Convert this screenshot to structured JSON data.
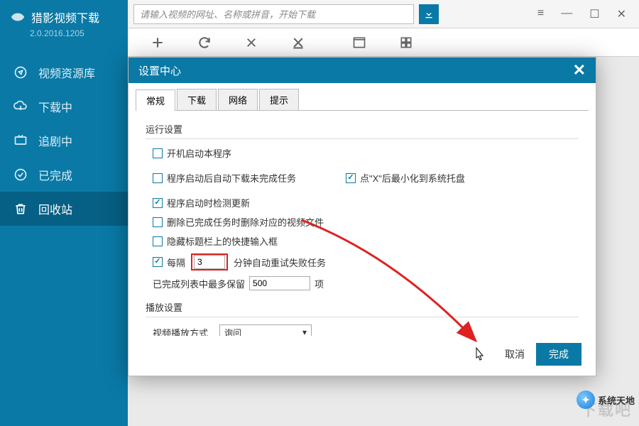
{
  "brand": {
    "title": "猎影视频下载",
    "version": "2.0.2016.1205"
  },
  "search": {
    "placeholder": "请输入视频的网址、名称或拼音，开始下载"
  },
  "nav": {
    "items": [
      {
        "label": "视频资源库"
      },
      {
        "label": "下载中"
      },
      {
        "label": "追剧中"
      },
      {
        "label": "已完成"
      },
      {
        "label": "回收站"
      }
    ]
  },
  "dialog": {
    "title": "设置中心",
    "tabs": [
      "常规",
      "下载",
      "网络",
      "提示"
    ],
    "section_run": "运行设置",
    "section_play": "播放设置",
    "opts": {
      "startup": "开机启动本程序",
      "resume": "程序启动后自动下载未完成任务",
      "minimize": "点\"X\"后最小化到系统托盘",
      "check_update": "程序启动时检测更新",
      "delete_file": "删除已完成任务时删除对应的视频文件",
      "hide_input": "隐藏标题栏上的快捷输入框",
      "retry_prefix": "每隔",
      "retry_value": "3",
      "retry_suffix": "分钟自动重试失败任务",
      "keep_prefix": "已完成列表中最多保留",
      "keep_value": "500",
      "keep_suffix": "项",
      "play_label": "视频播放方式",
      "play_selected": "询问"
    },
    "cancel": "取消",
    "done": "完成"
  },
  "watermark": "下载吧",
  "badge": "系统天地"
}
